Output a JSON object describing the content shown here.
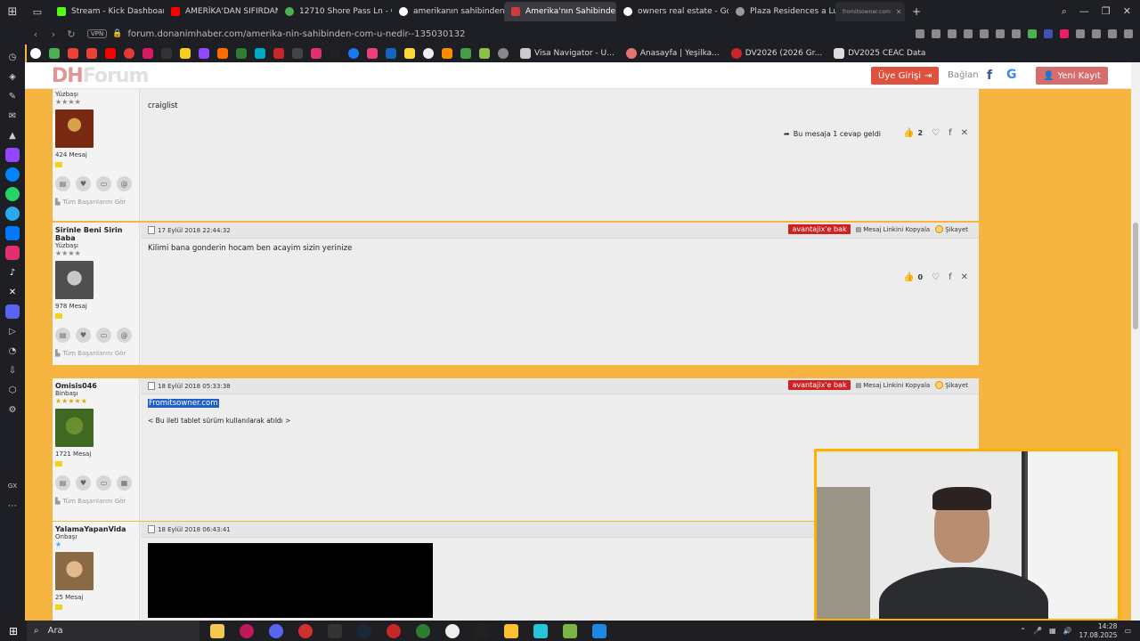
{
  "browser": {
    "tabs": [
      {
        "label": "Stream - Kick Dashboard",
        "color": "#53fc18"
      },
      {
        "label": "AMERİKA'DAN SIFIRDAN",
        "color": "#ff0000"
      },
      {
        "label": "12710 Shore Pass Ln - Go",
        "color": "#4caf50"
      },
      {
        "label": "amerikanın sahibindenmi",
        "color": "#ffffff"
      },
      {
        "label": "Amerika'nın Sahibinden.c",
        "color": "#cc3b3b"
      },
      {
        "label": "owners real estate - Goo",
        "color": "#ffffff"
      },
      {
        "label": "Plaza Residences a Luxur",
        "color": "#999999"
      },
      {
        "label": "fromitsowner.com",
        "color": "#bbbbbb"
      }
    ],
    "new_tab": "+",
    "url": "forum.donanimhaber.com/amerika-nin-sahibinden-com-u-nedir--135030132",
    "vpn": "VPN",
    "bookmarks": [
      {
        "label": "Visa Navigator - U..."
      },
      {
        "label": "Anasayfa | Yeşilka..."
      },
      {
        "label": "DV2026 (2026 Gr..."
      },
      {
        "label": "DV2025 CEAC Data"
      }
    ]
  },
  "site": {
    "logo_dh": "DH",
    "logo_forum": "Forum",
    "login": "Üye Girişi",
    "connect": "Bağlan",
    "facebook": "f",
    "google": "G",
    "register": "Yeni Kayıt"
  },
  "posts": [
    {
      "username": "",
      "rank": "Yüzbaşı",
      "stars": "★★★★",
      "messages": "424 Mesaj",
      "date": "",
      "text": "craiglist",
      "reply_info": "Bu mesaja 1 cevap geldi",
      "likes": "2",
      "avatar_color": "#7a3a1c"
    },
    {
      "username": "Sirinle Beni Sirin Baba",
      "rank": "Yüzbaşı",
      "stars": "★★★★",
      "messages": "978 Mesaj",
      "date": "17 Eylül 2018 22:44:32",
      "text": "Kilimi bana gonderin hocam ben acayim sizin yerinize",
      "likes": "0",
      "avatar_color": "#6b6b6b"
    },
    {
      "username": "Omisis046",
      "rank": "Binbaşı",
      "stars": "★★★★★",
      "messages": "1721 Mesaj",
      "date": "18 Eylül 2018 05:33:38",
      "text": "Fromitsowner.com",
      "footer": "< Bu ileti tablet sürüm kullanılarak atıldı >",
      "avatar_color": "#4c7a2a"
    },
    {
      "username": "YalamaYapanVida",
      "rank": "Onbaşı",
      "stars": "★",
      "messages": "25 Mesaj",
      "date": "18 Eylül 2018 06:43:41",
      "avatar_color": "#b08a5a"
    }
  ],
  "post_common": {
    "advantage_btn": "avantajix'e bak",
    "copy_link": "Mesaj Linkini Kopyala",
    "report": "Şikayet",
    "achievements": "Tüm Başarılarını Gör"
  },
  "taskbar": {
    "search_label": "Ara",
    "time": "14:28",
    "date": "17.08.2025"
  }
}
